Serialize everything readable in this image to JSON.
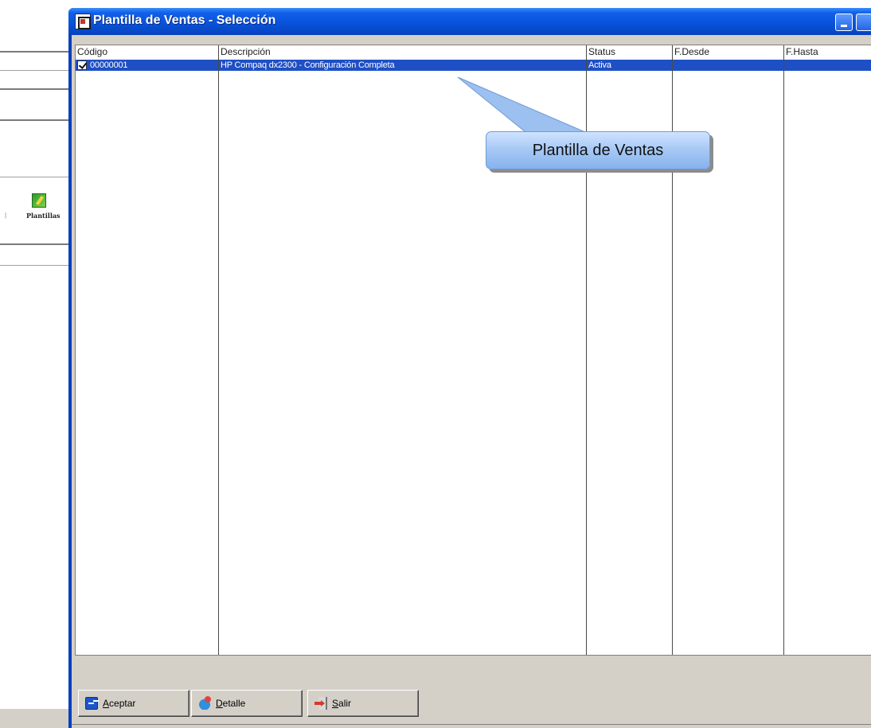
{
  "background_app": {
    "toolbar_label": "Plantillas"
  },
  "window": {
    "title": "Plantilla de Ventas - Selección"
  },
  "list": {
    "columns": [
      "Código",
      "Descripción",
      "Status",
      "F.Desde",
      "F.Hasta"
    ],
    "rows": [
      {
        "checked": true,
        "codigo": "00000001",
        "descripcion": "HP Compaq dx2300 - Configuración Completa",
        "status": "Activa",
        "f_desde": "",
        "f_hasta": ""
      }
    ]
  },
  "callout": {
    "text": "Plantilla de Ventas"
  },
  "buttons": {
    "aceptar": "Aceptar",
    "detalle": "Detalle",
    "salir": "Salir"
  },
  "colors": {
    "title_bar": "#0a53dc",
    "selection": "#1f4fc4",
    "callout_fill": "#a8caf6"
  }
}
